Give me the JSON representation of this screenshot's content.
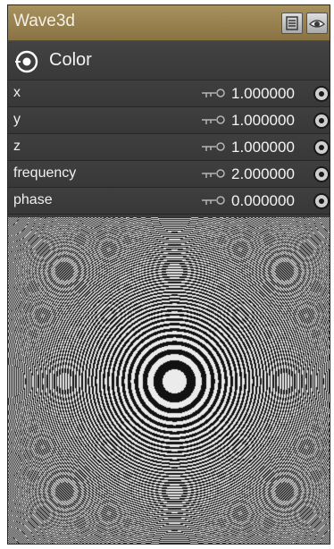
{
  "panel": {
    "title": "Wave3d",
    "title_buttons": [
      {
        "icon": "list-icon"
      },
      {
        "icon": "eye-icon"
      }
    ]
  },
  "section": {
    "icon": "target-icon",
    "label": "Color"
  },
  "params": [
    {
      "label": "x",
      "value": "1.000000",
      "key_icon": "key-icon"
    },
    {
      "label": "y",
      "value": "1.000000",
      "key_icon": "key-icon"
    },
    {
      "label": "z",
      "value": "1.000000",
      "key_icon": "key-icon"
    },
    {
      "label": "frequency",
      "value": "2.000000",
      "key_icon": "key-icon"
    },
    {
      "label": "phase",
      "value": "0.000000",
      "key_icon": "key-icon"
    }
  ],
  "colors": {
    "titlebar": "#9a8450",
    "panel_bg": "#3a3a3a",
    "text": "#f0f0f0"
  }
}
